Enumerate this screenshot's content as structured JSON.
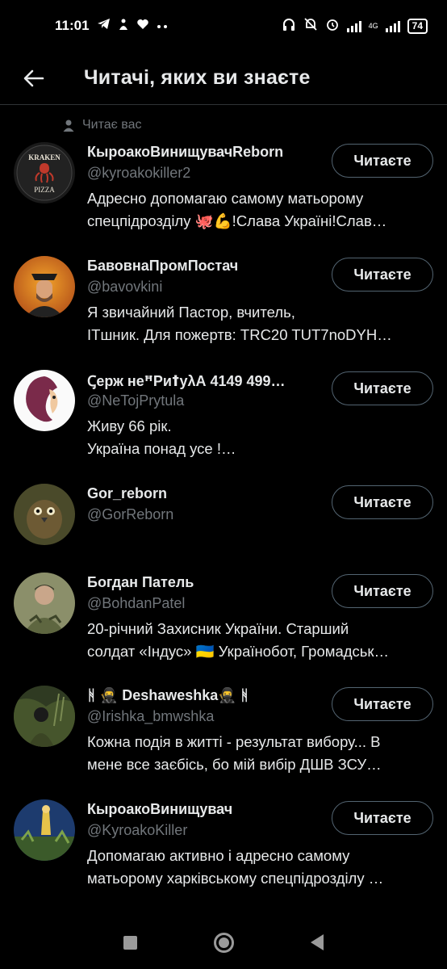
{
  "status_bar": {
    "time": "11:01",
    "battery": "74",
    "net_tag": "4G"
  },
  "header": {
    "title": "Читачі, яких ви знаєте"
  },
  "context_label": "Читає вас",
  "button_label": "Читаєте",
  "users": [
    {
      "name": "КыроакоВинищувачReborn",
      "handle": "@kyroakokiller2",
      "bio": [
        "Адресно допомагаю самому матьорому",
        "спецпідрозділу 🐙💪!Слава Україні!Слав…"
      ],
      "avatar_text": [
        "KRAKEN",
        "PIZZA"
      ]
    },
    {
      "name": "БавовнаПромПостач",
      "handle": "@bavovkini",
      "bio": [
        "Я звичайний Пастор, вчитель,",
        "ІТшник. Для пожертв: TRC20 TUT7noDYH…"
      ],
      "avatar_text": []
    },
    {
      "name": "Ꞔерж неꟸРиꝉуλА 4149 499…",
      "handle": "@NeTojPrytula",
      "bio": [
        "Живу 66 рік.",
        "Україна понад усе !…"
      ],
      "avatar_text": []
    },
    {
      "name": "Gor_reborn",
      "handle": "@GorReborn",
      "bio": [],
      "avatar_text": []
    },
    {
      "name": "Богдан Патель",
      "handle": "@BohdanPatel",
      "bio": [
        "20-річний Захисник України. Старший",
        "солдат «Індус» 🇺🇦 Українобот, Громадськ…"
      ],
      "avatar_text": []
    },
    {
      "name": "ᚻ 🥷 Deshaweshka🥷 ᚻ",
      "handle": "@Irishka_bmwshka",
      "bio": [
        "Кожна подія в житті - результат вибору... В",
        "мене все заєбісь, бо мій вибір ДШВ ЗСУ…"
      ],
      "avatar_text": []
    },
    {
      "name": "КыроакоВинищувач",
      "handle": "@KyroakoKiller",
      "bio": [
        "Допомагаю активно і адресно самому",
        "матьорому харківському спецпідрозділу …"
      ],
      "avatar_text": []
    }
  ],
  "colors": {
    "background": "#000000",
    "primary_text": "#e7e9ea",
    "secondary_text": "#71767b",
    "button_border": "#536471",
    "divider": "#2f3336"
  }
}
